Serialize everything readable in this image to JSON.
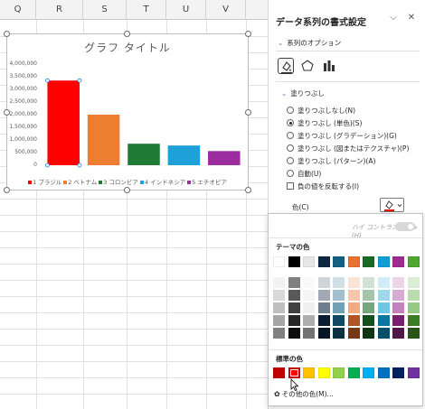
{
  "sheet": {
    "columns": [
      "Q",
      "R",
      "S",
      "T",
      "U",
      "V"
    ]
  },
  "chart_data": {
    "type": "bar",
    "title": "グラフ タイトル",
    "categories": [
      "1 ブラジル",
      "2 ベトナム",
      "3 コロンビア",
      "4 インドネシア",
      "5 エチオピア"
    ],
    "values": [
      3350000,
      2000000,
      850000,
      780000,
      560000
    ],
    "bar_colors": [
      "#ff0000",
      "#ed7d31",
      "#1f7a33",
      "#1ea0d8",
      "#9b2d9e"
    ],
    "yticks": [
      "4,000,000",
      "3,500,000",
      "3,000,000",
      "2,500,000",
      "2,000,000",
      "1,500,000",
      "1,000,000",
      "500,000",
      "0"
    ],
    "ylim": [
      0,
      4000000
    ],
    "legend": "bottom",
    "grid": false
  },
  "pane": {
    "title": "データ系列の書式設定",
    "series_options": "系列のオプション",
    "fill_section": "塗りつぶし",
    "options": [
      {
        "label": "塗りつぶしなし(N)",
        "selected": false
      },
      {
        "label": "塗りつぶし (単色)(S)",
        "selected": true
      },
      {
        "label": "塗りつぶし (グラデーション)(G)",
        "selected": false
      },
      {
        "label": "塗りつぶし (図またはテクスチャ)(P)",
        "selected": false
      },
      {
        "label": "塗りつぶし (パターン)(A)",
        "selected": false
      },
      {
        "label": "自動(U)",
        "selected": false
      }
    ],
    "invert_label": "負の値を反転する(I)",
    "color_label": "色(C)",
    "current_color": "#ff0000"
  },
  "dropdown": {
    "high_contrast": "ハイ コントラストのみ(H)",
    "theme_header": "テーマの色",
    "standard_header": "標準の色",
    "more_colors": "その他の色(M)...",
    "theme_colors": [
      "#ffffff",
      "#000000",
      "#e7e6e6",
      "#0e2841",
      "#156082",
      "#e97132",
      "#196b24",
      "#0f9ed5",
      "#a02b93",
      "#4ea72e"
    ],
    "standard_colors": [
      "#c00000",
      "#ff0000",
      "#ffc000",
      "#ffff00",
      "#92d050",
      "#00b050",
      "#00b0f0",
      "#0070c0",
      "#002060",
      "#7030a0"
    ],
    "selected_standard": "#ff0000"
  }
}
